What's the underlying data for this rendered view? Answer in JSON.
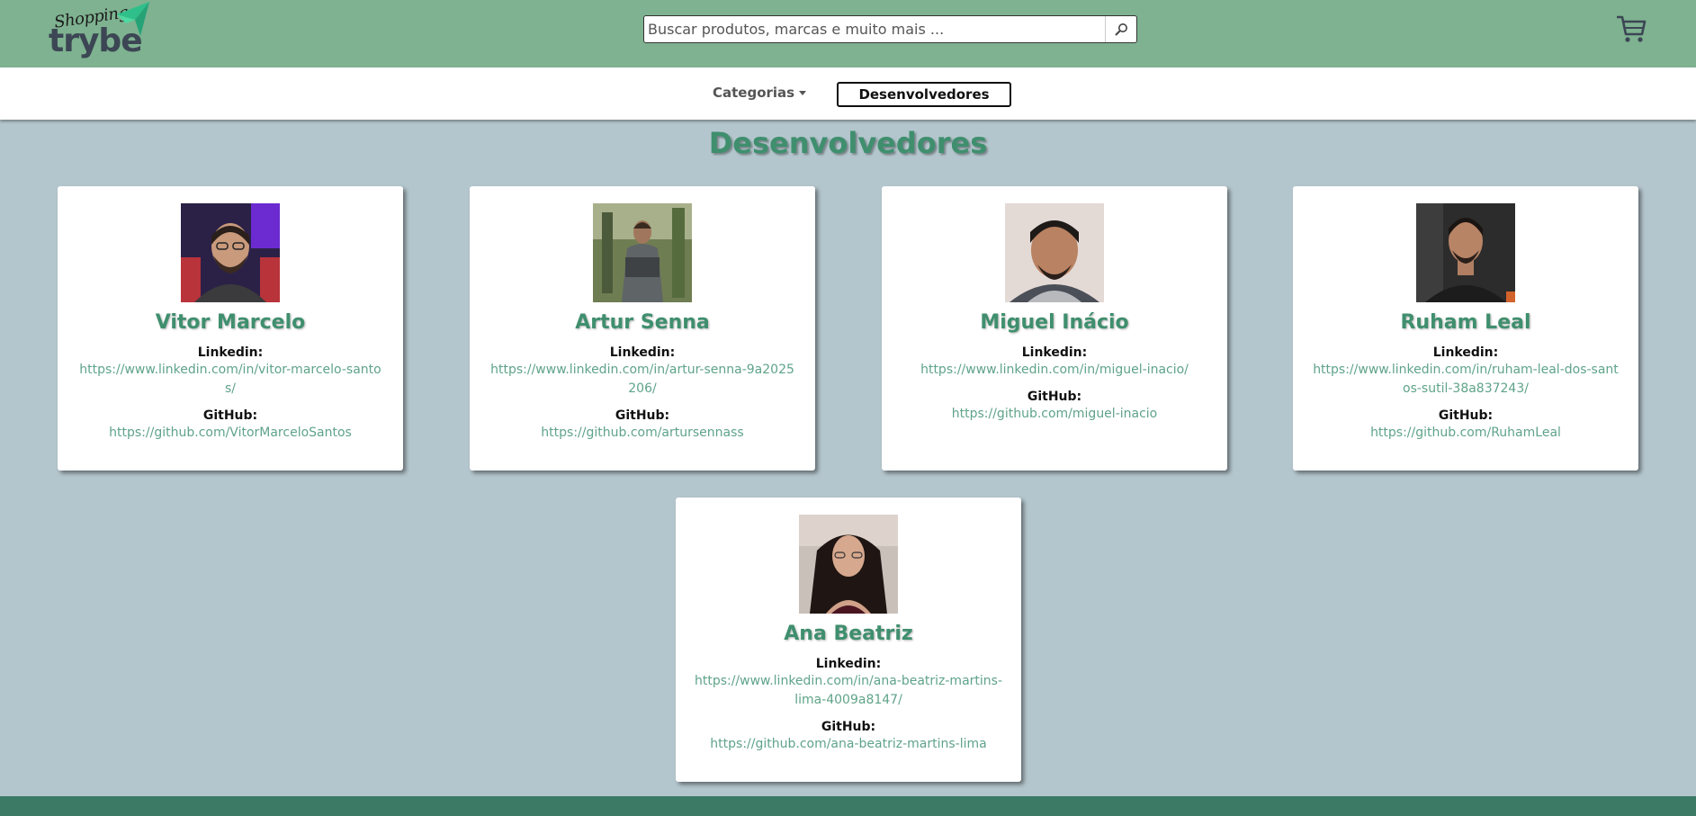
{
  "header": {
    "logo": {
      "script_text": "Shopping",
      "word_text": "trybe"
    },
    "search": {
      "placeholder": "Buscar produtos, marcas e muito mais ...",
      "value": ""
    },
    "icons": {
      "search": "search-icon",
      "cart": "cart-icon"
    }
  },
  "nav": {
    "categories_label": "Categorias",
    "developers_label": "Desenvolvedores"
  },
  "main": {
    "title": "Desenvolvedores",
    "labels": {
      "linkedin": "Linkedin:",
      "github": "GitHub:"
    },
    "developers": [
      {
        "name": "Vitor Marcelo",
        "linkedin": "https://www.linkedin.com/in/vitor-marcelo-santos/",
        "github": "https://github.com/VitorMarceloSantos"
      },
      {
        "name": "Artur Senna",
        "linkedin": "https://www.linkedin.com/in/artur-senna-9a2025206/",
        "github": "https://github.com/artursennass"
      },
      {
        "name": "Miguel Inácio",
        "linkedin": "https://www.linkedin.com/in/miguel-inacio/",
        "github": "https://github.com/miguel-inacio"
      },
      {
        "name": "Ruham Leal",
        "linkedin": "https://www.linkedin.com/in/ruham-leal-dos-santos-sutil-38a837243/",
        "github": "https://github.com/RuhamLeal"
      },
      {
        "name": "Ana Beatriz",
        "linkedin": "https://www.linkedin.com/in/ana-beatriz-martins-lima-4009a8147/",
        "github": "https://github.com/ana-beatriz-martins-lima"
      }
    ]
  },
  "colors": {
    "header_bg": "#7eb290",
    "page_bg": "#b4c6cd",
    "accent": "#3f8f6e",
    "link": "#5fa38a",
    "footer_bg": "#3c7a66"
  }
}
